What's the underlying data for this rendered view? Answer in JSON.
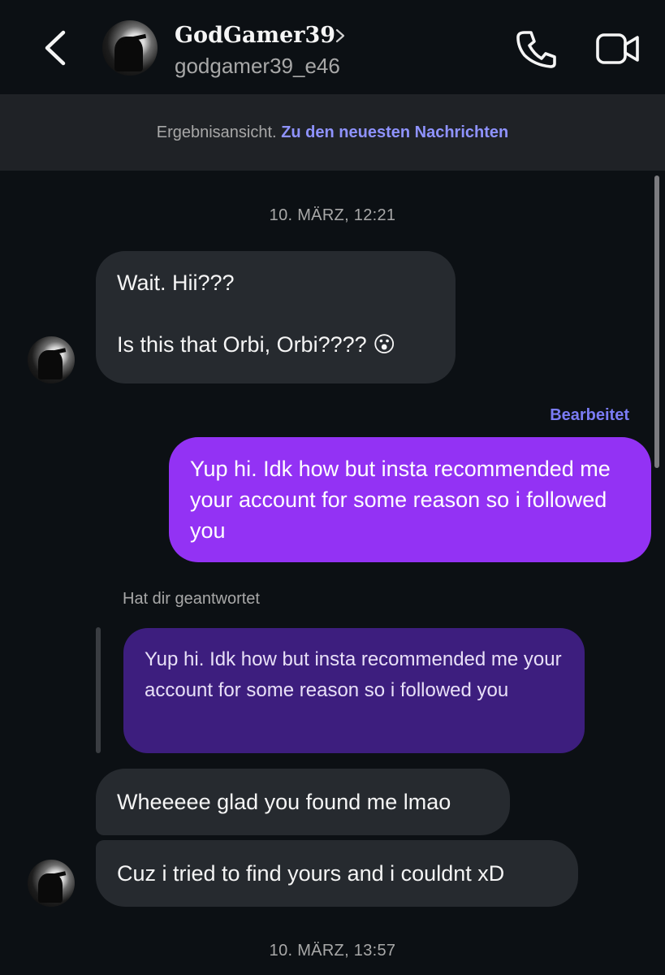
{
  "header": {
    "name": "GodGamer39",
    "username": "godgamer39_e46",
    "icons": {
      "back": "chevron-left-icon",
      "name_chevron": "chevron-right-icon",
      "call": "phone-icon",
      "video": "video-camera-icon"
    }
  },
  "banner": {
    "prefix": "Ergebnisansicht.",
    "link": "Zu den neuesten Nachrichten"
  },
  "messages": {
    "timestamp_1": "10. MÄRZ, 12:21",
    "m1_line1": "Wait. Hii???",
    "m1_line2": "Is this that Orbi, Orbi???? 😮",
    "edited_label": "Bearbeitet",
    "m2": "Yup hi. Idk how but insta recommended me your account for some reason so i followed you",
    "replied_label": "Hat dir geantwortet",
    "quoted": "Yup hi. Idk how but insta recommended me your account for some reason so i followed you",
    "m3": "Wheeeee glad you found me lmao",
    "m4": "Cuz i tried to find yours and i couldnt xD",
    "timestamp_2": "10. MÄRZ, 13:57"
  },
  "colors": {
    "background": "#0c1014",
    "incoming_bubble": "#262a2f",
    "outgoing_bubble": "#9332f4",
    "quoted_bubble": "#3d1e7e",
    "link": "#8f93ff"
  }
}
